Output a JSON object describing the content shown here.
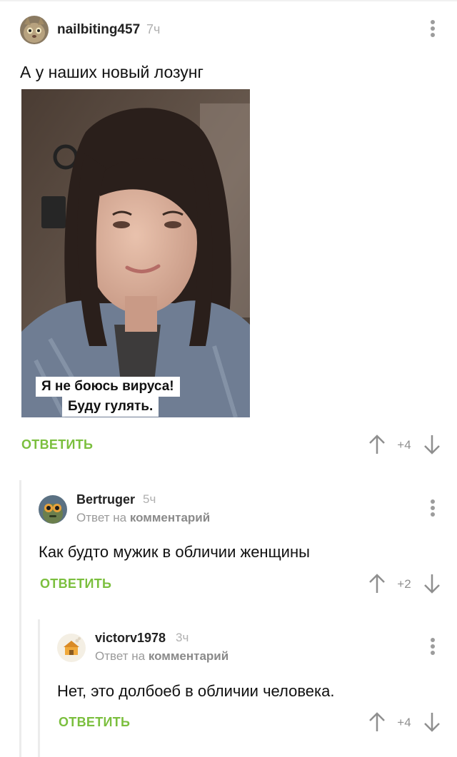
{
  "post": {
    "username": "nailbiting457",
    "time": "7ч",
    "text": "А у наших новый лозунг",
    "image_caption_line1": "Я не боюсь вируса!",
    "image_caption_line2": "Буду гулять.",
    "reply_label": "ОТВЕТИТЬ",
    "score": "+4"
  },
  "comments": [
    {
      "username": "Bertruger",
      "time": "5ч",
      "reply_to_prefix": "Ответ на",
      "reply_to_target": "комментарий",
      "text": "Как будто мужик в обличии женщины",
      "reply_label": "ОТВЕТИТЬ",
      "score": "+2"
    },
    {
      "username": "victorv1978",
      "time": "3ч",
      "reply_to_prefix": "Ответ на",
      "reply_to_target": "комментарий",
      "text": "Нет, это долбоеб в обличии человека.",
      "reply_label": "ОТВЕТИТЬ",
      "score": "+4"
    }
  ],
  "colors": {
    "accent_green": "#7bbf3e",
    "muted_gray": "#9a9a9a",
    "thread_line": "#ececec"
  },
  "icons": [
    "menu-dots-icon",
    "arrow-up-icon",
    "arrow-down-icon",
    "avatar-cat",
    "avatar-alien",
    "avatar-house"
  ]
}
